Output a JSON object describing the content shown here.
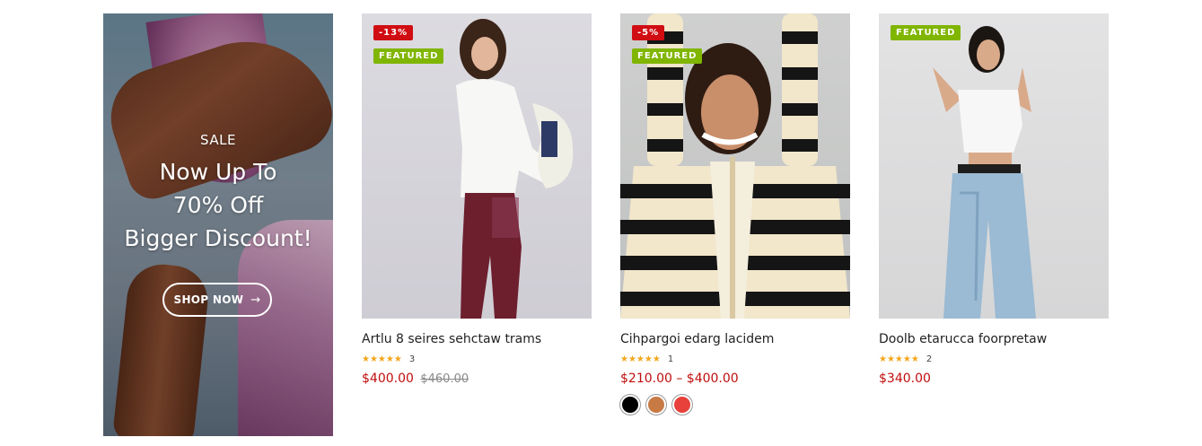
{
  "banner": {
    "sale": "SALE",
    "line1": "Now Up To",
    "line2": "70% Off",
    "line3": "Bigger Discount!",
    "button": "SHOP NOW",
    "button_icon": "arrow-right-icon"
  },
  "products": [
    {
      "sale_badge": "-13%",
      "featured_badge": "FEATURED",
      "name": "Artlu 8 seires sehctaw trams",
      "stars": "★★★★★",
      "rating_count": "3",
      "price": "$400.00",
      "old_price": "$460.00"
    },
    {
      "sale_badge": "-5%",
      "featured_badge": "FEATURED",
      "name": "Cihpargoi edarg lacidem",
      "stars": "★★★★★",
      "rating_count": "1",
      "price": "$210.00 – $400.00",
      "swatch_colors": [
        "#000000",
        "#c87a45",
        "#e8403a"
      ]
    },
    {
      "featured_badge": "FEATURED",
      "name": "Doolb etarucca foorpretaw",
      "stars": "★★★★★",
      "rating_count": "2",
      "price": "$340.00"
    }
  ],
  "colors": {
    "sale_badge": "#d00d12",
    "featured_badge": "#80b500",
    "price": "#c10d0d",
    "stars": "#f3a51b"
  }
}
